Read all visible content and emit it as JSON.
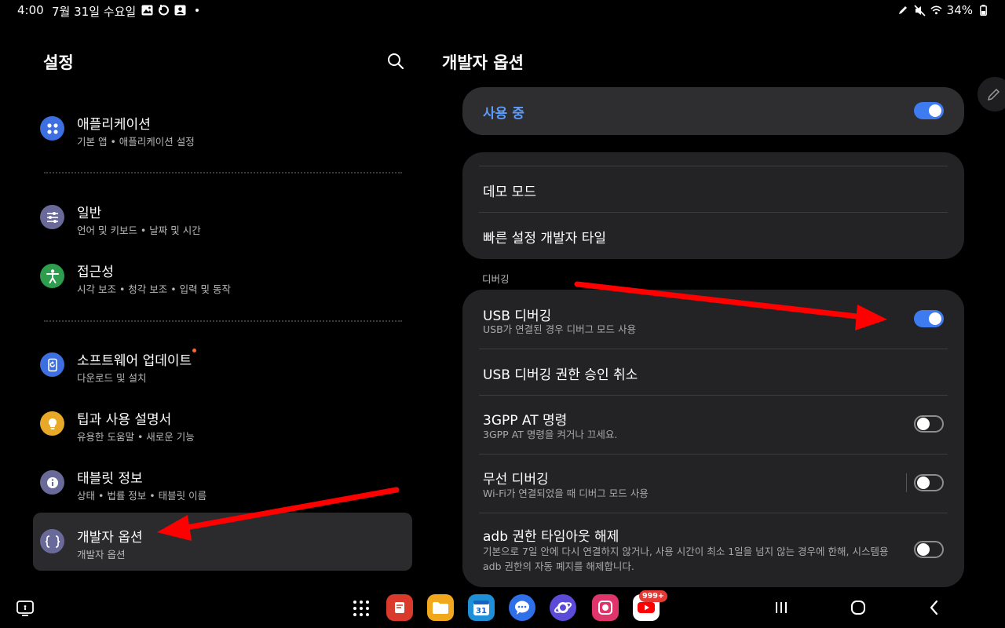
{
  "status_bar": {
    "time": "4:00",
    "date": "7월 31일 수요일",
    "battery": "34%",
    "notification_icons": [
      "gallery-icon",
      "bixby-icon",
      "contact-card-icon",
      "more-dot-icon"
    ],
    "system_icons": [
      "pen-icon",
      "mute-icon",
      "wifi-icon",
      "battery-icon"
    ]
  },
  "left_pane": {
    "title": "설정",
    "search_icon": "search-icon",
    "items": [
      {
        "title": "애플리케이션",
        "subtitle": "기본 앱 • 애플리케이션 설정",
        "icon": "apps-icon",
        "color": "#3d6fe0"
      },
      {
        "title": "일반",
        "subtitle": "언어 및 키보드 • 날짜 및 시간",
        "icon": "sliders-icon",
        "color": "#6a6a9a"
      },
      {
        "title": "접근성",
        "subtitle": "시각 보조 • 청각 보조 • 입력 및 동작",
        "icon": "accessibility-icon",
        "color": "#2e9e4e"
      },
      {
        "title": "소프트웨어 업데이트",
        "subtitle": "다운로드 및 설치",
        "icon": "software-update-icon",
        "color": "#3d6fe0",
        "has_badge_dot": true
      },
      {
        "title": "팁과 사용 설명서",
        "subtitle": "유용한 도움말 • 새로운 기능",
        "icon": "lightbulb-icon",
        "color": "#e8a929"
      },
      {
        "title": "태블릿 정보",
        "subtitle": "상태 • 법률 정보 • 태블릿 이름",
        "icon": "info-icon",
        "color": "#6a6a9a"
      },
      {
        "title": "개발자 옵션",
        "subtitle": "개발자 옵션",
        "icon": "braces-icon",
        "color": "#6a6a9a",
        "selected": true
      }
    ]
  },
  "right_pane": {
    "title": "개발자 옵션",
    "edit_icon": "pencil-icon",
    "main_toggle": {
      "label": "사용 중",
      "on": true,
      "label_color": "#5d9cf8"
    },
    "group1": [
      {
        "title": "데모 모드"
      },
      {
        "title": "빠른 설정 개발자 타일"
      }
    ],
    "section_label": "디버깅",
    "debug_rows": [
      {
        "title": "USB 디버깅",
        "subtitle": "USB가 연결된 경우 디버그 모드 사용",
        "toggle": true,
        "on": true
      },
      {
        "title": "USB 디버깅 권한 승인 취소",
        "toggle": false
      },
      {
        "title": "3GPP AT 명령",
        "subtitle": "3GPP AT 명령을 켜거나 끄세요.",
        "toggle": true,
        "on": false
      },
      {
        "title": "무선 디버깅",
        "subtitle": "Wi-Fi가 연결되었을 때 디버그 모드 사용",
        "toggle": true,
        "on": false,
        "separator": true
      },
      {
        "title": "adb 권한 타임아웃 해제",
        "subtitle_line1": "기본으로 7일 안에 다시 연결하지 않거나, 사용 시간이 최소 1일을 넘지 않는 경우에 한해, 시스템용",
        "subtitle_line2": "adb 권한의 자동 폐지를 해제합니다.",
        "toggle": true,
        "on": false
      }
    ]
  },
  "taskbar": {
    "left_icon": "screen-capture-icon",
    "apps_icon": "app-grid-icon",
    "apps": [
      {
        "name": "notes-app-icon",
        "color": "#d93a2b"
      },
      {
        "name": "my-files-app-icon",
        "color": "#f2a81d"
      },
      {
        "name": "calendar-app-icon",
        "color": "#1f8fd8",
        "label": "31"
      },
      {
        "name": "messages-app-icon",
        "color": "#2f6fe8"
      },
      {
        "name": "internet-app-icon",
        "color": "#5b4bd8"
      },
      {
        "name": "screen-recorder-app-icon",
        "color": "#e0356a"
      },
      {
        "name": "youtube-app-icon",
        "color": "#ffffff"
      }
    ],
    "youtube_badge": "999+",
    "nav": [
      "recents-icon",
      "home-icon",
      "back-icon"
    ]
  },
  "annotation_color": "#ff0000"
}
